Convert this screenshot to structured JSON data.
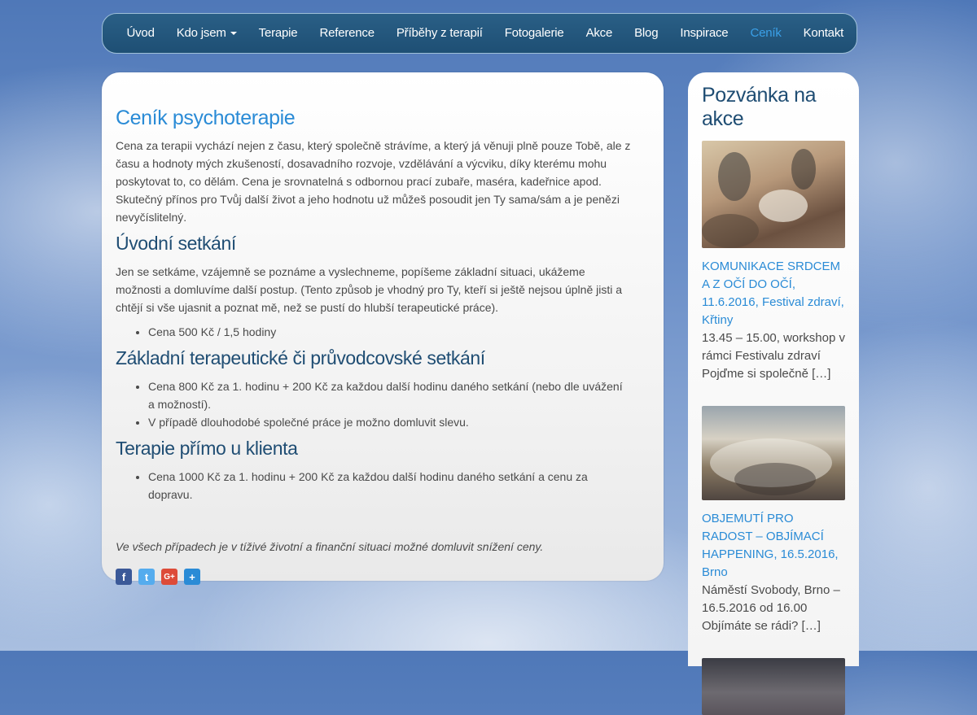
{
  "nav": {
    "items": [
      {
        "label": "Úvod"
      },
      {
        "label": "Kdo jsem"
      },
      {
        "label": "Terapie"
      },
      {
        "label": "Reference"
      },
      {
        "label": "Příběhy z terapií"
      },
      {
        "label": "Fotogalerie"
      },
      {
        "label": "Akce"
      },
      {
        "label": "Blog"
      },
      {
        "label": "Inspirace"
      },
      {
        "label": "Ceník"
      },
      {
        "label": "Kontakt"
      }
    ],
    "active_index": 9,
    "active_color": "#3aa0e8"
  },
  "main": {
    "title": "Ceník psychoterapie",
    "intro": "Cena za terapii vychází nejen z času, který společně strávíme, a který já věnuji plně pouze Tobě, ale z času a hodnoty mých zkušeností, dosavadního rozvoje, vzdělávání a výcviku, díky kterému mohu poskytovat to, co dělám. Cena je srovnatelná s odbornou prací zubaře, maséra, kadeřnice apod. Skutečný přínos pro Tvůj další život a jeho hodnotu už můžeš posoudit jen Ty sama/sám a je penězi nevyčíslitelný.",
    "sections": [
      {
        "heading": "Úvodní setkání",
        "text": "Jen se setkáme, vzájemně se poznáme a vyslechneme, popíšeme základní situaci, ukážeme možnosti a domluvíme další postup. (Tento způsob je vhodný pro Ty, kteří si ještě nejsou úplně jisti a chtějí si vše ujasnit a poznat mě, než se pustí do hlubší terapeutické práce).",
        "bullets": [
          "Cena 500 Kč / 1,5 hodiny"
        ]
      },
      {
        "heading": "Základní terapeutické či průvodcovské setkání",
        "bullets": [
          "Cena 800 Kč za 1. hodinu + 200 Kč za každou další hodinu daného setkání (nebo dle uvážení a možností).",
          "V případě dlouhodobé společné práce je možno domluvit slevu."
        ]
      },
      {
        "heading": "Terapie přímo u klienta",
        "bullets": [
          "Cena 1000 Kč za 1. hodinu + 200 Kč za každou další hodinu daného setkání a cenu za dopravu."
        ]
      }
    ],
    "note": "Ve všech případech je v tíživé životní a finanční situaci možné domluvit snížení ceny.",
    "share": {
      "facebook": "f",
      "twitter": "t",
      "gplus": "G+",
      "share": "+"
    }
  },
  "sidebar": {
    "title": "Pozvánka na akce",
    "events": [
      {
        "title": "Komunikace srdcem a z očí do očí, 11.6.2016,",
        "title_tail": "Festival zdraví, Křtiny",
        "desc": "13.45 – 15.00, workshop v rámci Festivalu zdraví Pojďme si společně […]"
      },
      {
        "title": "Objemutí pro radost – objímací happening, 16.5.2016,",
        "title_tail": "Brno",
        "desc": "Náměstí Svobody, Brno – 16.5.2016 od 16.00 Objímáte se rádi? […]"
      }
    ]
  },
  "colors": {
    "nav_bg": "#1e4f74",
    "link": "#2a8bd6",
    "heading": "#1f4d73"
  }
}
